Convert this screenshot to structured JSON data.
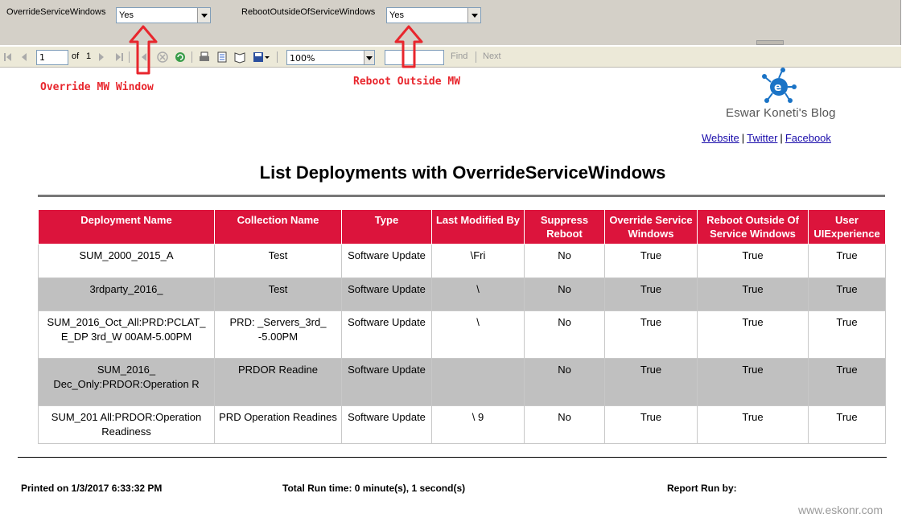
{
  "parameters": {
    "override_label": "OverrideServiceWindows",
    "override_value": "Yes",
    "reboot_label": "RebootOutsideOfServiceWindows",
    "reboot_value": "Yes"
  },
  "toolbar": {
    "page_current": "1",
    "page_of": "of",
    "page_total": "1",
    "zoom": "100%",
    "find_label": "Find",
    "next_label": "Next"
  },
  "annotations": {
    "override": "Override MW Window",
    "reboot": "Reboot Outside MW",
    "color": "#e8262d"
  },
  "header": {
    "blog_name": "Eswar Koneti's Blog",
    "links": [
      "Website",
      "Twitter",
      "Facebook"
    ],
    "title": "List Deployments with OverrideServiceWindows"
  },
  "table": {
    "header_color": "#dc143c",
    "columns": [
      "Deployment Name",
      "Collection Name",
      "Type",
      "Last Modified By",
      "Suppress Reboot",
      "Override Service Windows",
      "Reboot Outside Of Service Windows",
      "User UIExperience"
    ],
    "rows": [
      {
        "deployment": "SUM_2000_2015_A",
        "collection": "Test",
        "type": "Software Update",
        "modified_by": "\\Fri",
        "suppress": "No",
        "override": "True",
        "reboot": "True",
        "ux": "True"
      },
      {
        "deployment": "3rdparty_2016_",
        "collection": "Test",
        "type": "Software Update",
        "modified_by": "\\",
        "suppress": "No",
        "override": "True",
        "reboot": "True",
        "ux": "True"
      },
      {
        "deployment": "SUM_2016_Oct_All:PRD:PCLAT_ E_DP 3rd_W 00AM-5.00PM",
        "collection": "PRD: _Servers_3rd_ -5.00PM",
        "type": "Software Update",
        "modified_by": "\\",
        "suppress": "No",
        "override": "True",
        "reboot": "True",
        "ux": "True"
      },
      {
        "deployment": "SUM_2016_ Dec_Only:PRDOR:Operation R",
        "collection": "PRDOR Readine",
        "type": "Software Update",
        "modified_by": "",
        "suppress": "No",
        "override": "True",
        "reboot": "True",
        "ux": "True"
      },
      {
        "deployment": "SUM_201 All:PRDOR:Operation Readiness",
        "collection": "PRD Operation Readines",
        "type": "Software Update",
        "modified_by": "\\ 9",
        "suppress": "No",
        "override": "True",
        "reboot": "True",
        "ux": "True"
      }
    ]
  },
  "footer": {
    "printed_on": "Printed on 1/3/2017 6:33:32 PM",
    "run_time": "Total Run time: 0 minute(s), 1 second(s)",
    "report_run_by": "Report Run by:"
  },
  "watermark": "www.eskonr.com"
}
